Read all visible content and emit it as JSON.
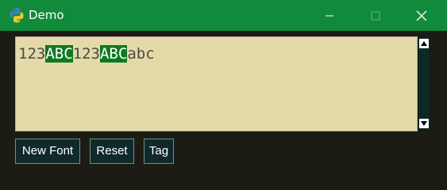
{
  "window": {
    "title": "Demo",
    "icon": "python-logo-icon",
    "controls": [
      "minimize-icon",
      "maximize-icon",
      "close-icon"
    ]
  },
  "text_area": {
    "segments": [
      {
        "text": "123",
        "tagged": false
      },
      {
        "text": "ABC",
        "tagged": true
      },
      {
        "text": "123",
        "tagged": false
      },
      {
        "text": "ABC",
        "tagged": true
      },
      {
        "text": "abc",
        "tagged": false
      }
    ]
  },
  "buttons": {
    "new_font": "New Font",
    "reset": "Reset",
    "tag": "Tag"
  },
  "colors": {
    "titlebar": "#128a3c",
    "window_bg": "#1c1c14",
    "text_bg": "#e4daa9",
    "tag_bg": "#0e7a1f",
    "button_bg": "#102a2c"
  }
}
